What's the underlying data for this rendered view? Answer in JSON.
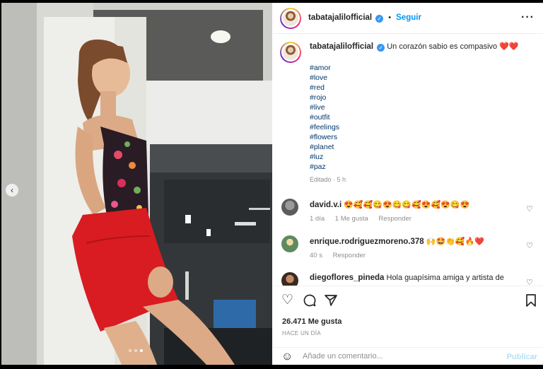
{
  "post": {
    "username": "tabatajalilofficial",
    "follow_label": "Seguir",
    "separator": "•",
    "more_label": "···"
  },
  "caption": {
    "username": "tabatajalilofficial",
    "text": "Un corazón sabio es compasivo ❤️❤️",
    "hashtags": [
      "#amor",
      "#love",
      "#red",
      "#rojo",
      "#live",
      "#outfit",
      "#feelings",
      "#flowers",
      "#planet",
      "#luz",
      "#paz"
    ],
    "edited": "Editado · 5 h"
  },
  "comments": [
    {
      "username": "david.v.i",
      "text": "😍🥰🥰😋😍😋😋🥰😍🥰😍😋😍",
      "time": "1 día",
      "likes": "1 Me gusta",
      "reply_label": "Responder"
    },
    {
      "username": "enrique.rodriguezmoreno.378",
      "text": "🙌🤩👏🥰🔥❤️",
      "time": "40 s",
      "reply_label": "Responder"
    },
    {
      "username": "diegoflores_pineda",
      "text": "Hola guapísima amiga y artista de"
    }
  ],
  "stats": {
    "likes": "26.471 Me gusta",
    "time_ago": "HACE UN DÍA"
  },
  "comment_box": {
    "placeholder": "Añade un comentario...",
    "publish_label": "Publicar"
  },
  "icons": {
    "verified": "✓",
    "heart": "♡",
    "comment": "💬",
    "share": "➤",
    "bookmark": "🔖",
    "emoji": "☺",
    "prev": "‹"
  },
  "carousel": {
    "current": 3,
    "total": 3
  },
  "colors": {
    "link": "#0095f6",
    "hashtag": "#00376b",
    "dress": "#d81c22"
  }
}
